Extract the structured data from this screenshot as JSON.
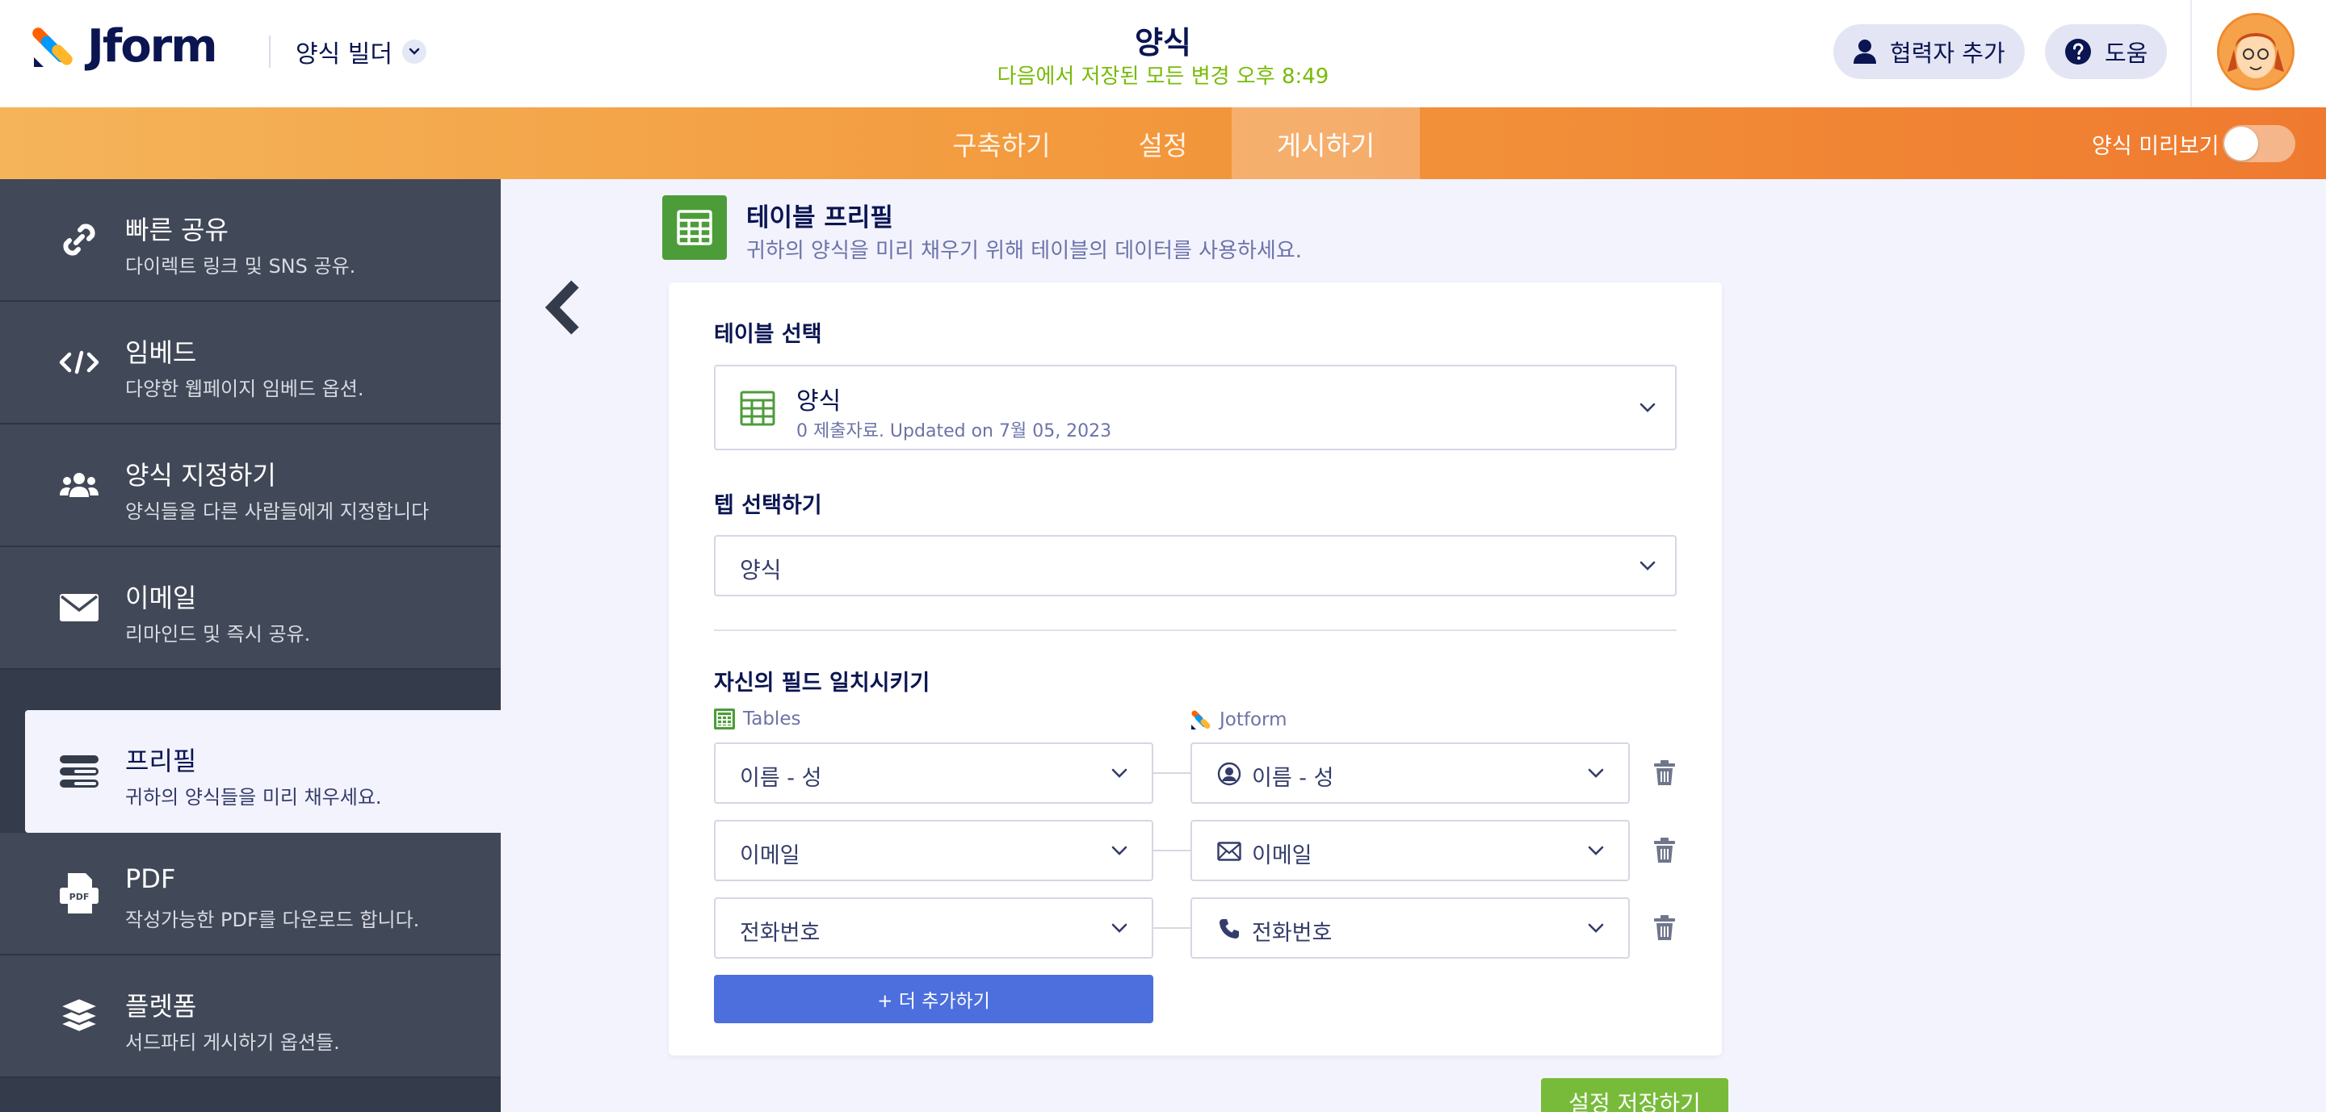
{
  "header": {
    "brand": "Jform",
    "builder_label": "양식 빌더",
    "form_title": "양식",
    "save_status": "다음에서 저장된 모든 변경 오후 8:49",
    "add_collaborator": "협력자 추가",
    "help": "도움"
  },
  "nav": {
    "tabs": [
      {
        "label": "구축하기"
      },
      {
        "label": "설정"
      },
      {
        "label": "게시하기"
      }
    ],
    "active_tab": "게시하기",
    "preview_label": "양식 미리보기",
    "preview_enabled": false,
    "accent_gradient": [
      "#f5b45a",
      "#ef7a2f"
    ]
  },
  "sidebar": {
    "items": [
      {
        "title": "빠른 공유",
        "desc": "다이렉트 링크 및 SNS 공유.",
        "icon": "link-icon"
      },
      {
        "title": "임베드",
        "desc": "다양한 웹페이지 임베드 옵션.",
        "icon": "code-icon"
      },
      {
        "title": "양식 지정하기",
        "desc": "양식들을 다른 사람들에게 지정합니다",
        "icon": "users-icon"
      },
      {
        "title": "이메일",
        "desc": "리마인드 및 즉시 공유.",
        "icon": "mail-icon"
      },
      {
        "title": "프리필",
        "desc": "귀하의 양식들을 미리 채우세요.",
        "icon": "prefill-icon"
      },
      {
        "title": "PDF",
        "desc": "작성가능한 PDF를 다운로드 합니다.",
        "icon": "pdf-icon"
      },
      {
        "title": "플렛폼",
        "desc": "서드파티 게시하기 옵션들.",
        "icon": "layers-icon"
      }
    ],
    "active_index": 4
  },
  "main": {
    "title": "테이블 프리필",
    "description": "귀하의 양식을 미리 채우기 위해 테이블의 데이터를 사용하세요.",
    "table_select_label": "테이블 선택",
    "table_name": "양식",
    "table_meta": "0 제출자료. Updated on 7월 05, 2023",
    "tab_select_label": "텝 선택하기",
    "tab_value": "양식",
    "match_label": "자신의 필드 일치시키기",
    "col_tables": "Tables",
    "col_jotform": "Jotform",
    "mappings": [
      {
        "table_field": "이름 - 성",
        "form_field": "이름 - 성",
        "form_icon": "user-circle-icon"
      },
      {
        "table_field": "이메일",
        "form_field": "이메일",
        "form_icon": "envelope-icon"
      },
      {
        "table_field": "전화번호",
        "form_field": "전화번호",
        "form_icon": "phone-icon"
      }
    ],
    "add_more": "+ 더 추가하기",
    "save_settings": "설정 저장하기"
  }
}
